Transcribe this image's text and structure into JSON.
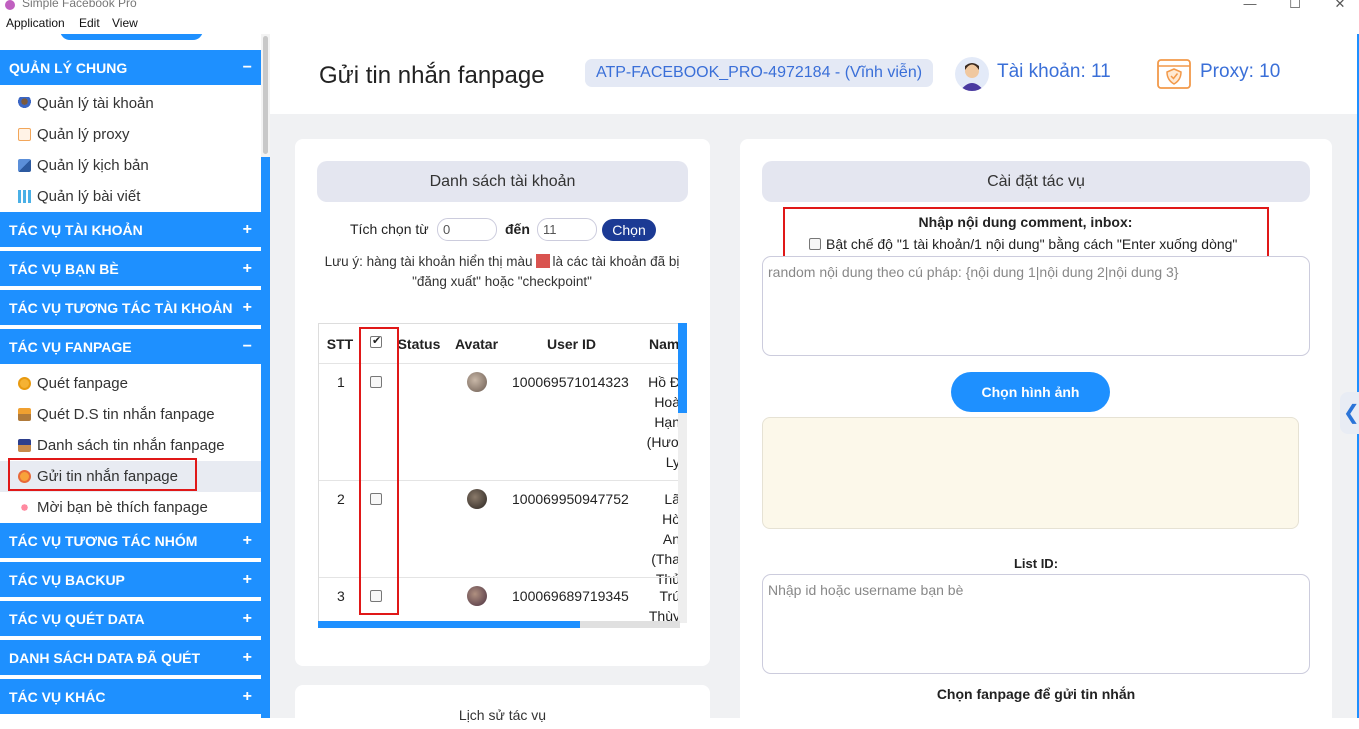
{
  "window": {
    "title": "Simple Facebook Pro",
    "buttons": [
      "—",
      "☐",
      "✕"
    ]
  },
  "menu": [
    "Application",
    "Edit",
    "View"
  ],
  "sidebar": {
    "sections": [
      {
        "label": "QUẢN LÝ CHUNG",
        "sign": "−",
        "items": [
          "Quản lý tài khoản",
          "Quản lý proxy",
          "Quản lý kịch bản",
          "Quản lý bài viết"
        ]
      },
      {
        "label": "TÁC VỤ TÀI KHOẢN",
        "sign": "+"
      },
      {
        "label": "TÁC VỤ BẠN BÈ",
        "sign": "+"
      },
      {
        "label": "TÁC VỤ TƯƠNG TÁC TÀI KHOẢN",
        "sign": "+"
      },
      {
        "label": "TÁC VỤ FANPAGE",
        "sign": "−",
        "items": [
          "Quét fanpage",
          "Quét D.S tin nhắn fanpage",
          "Danh sách tin nhắn fanpage",
          "Gửi tin nhắn fanpage",
          "Mời bạn bè thích fanpage"
        ]
      },
      {
        "label": "TÁC VỤ TƯƠNG TÁC NHÓM",
        "sign": "+"
      },
      {
        "label": "TÁC VỤ BACKUP",
        "sign": "+"
      },
      {
        "label": "TÁC VỤ QUÉT DATA",
        "sign": "+"
      },
      {
        "label": "DANH SÁCH DATA ĐÃ QUÉT",
        "sign": "+"
      },
      {
        "label": "TÁC VỤ KHÁC",
        "sign": "+"
      }
    ],
    "active_item": "Gửi tin nhắn fanpage"
  },
  "header": {
    "page_title": "Gửi tin nhắn fanpage",
    "license": "ATP-FACEBOOK_PRO-4972184 - (Vĩnh viễn)",
    "accounts": "Tài khoản: 11",
    "proxy": "Proxy: 10"
  },
  "account_list": {
    "title": "Danh sách tài khoản",
    "select_from_label": "Tích chọn từ",
    "from_value": "0",
    "to_label": "đến",
    "to_value": "11",
    "choose_button": "Chọn",
    "note_before": "Lưu ý: hàng tài khoản hiển thị màu",
    "note_after": "là các tài khoản đã bị \"đăng xuất\" hoặc \"checkpoint\"",
    "columns": [
      "STT",
      "",
      "Status",
      "Avatar",
      "User ID",
      "Nam"
    ],
    "rows": [
      {
        "stt": "1",
        "user_id": "100069571014323",
        "name_lines": [
          "Hồ Đ",
          "Hoà",
          "Hạn",
          "(Hươ",
          "Ly"
        ]
      },
      {
        "stt": "2",
        "user_id": "100069950947752",
        "name_lines": [
          "Lã Hò",
          "An",
          "(Tha",
          "Thủ"
        ]
      },
      {
        "stt": "3",
        "user_id": "100069689719345",
        "name_lines": [
          "Trú",
          "Thùy"
        ]
      }
    ]
  },
  "history": {
    "title": "Lịch sử tác vụ"
  },
  "settings": {
    "title": "Cài đặt tác vụ",
    "comment_label": "Nhập nội dung comment, inbox:",
    "mode_checkbox": "Bật chế độ \"1 tài khoản/1 nội dung\" bằng cách \"Enter xuống dòng\"",
    "content_placeholder": "random nội dung theo cú pháp: {nội dung 1|nội dung 2|nội dung 3}",
    "image_button": "Chọn hình ảnh",
    "list_id_label": "List ID:",
    "list_id_placeholder": "Nhập id hoặc username bạn bè",
    "fanpage_label": "Chọn fanpage để gửi tin nhắn"
  },
  "colors": {
    "primary": "#1e90ff",
    "navy": "#1c3a94",
    "highlight_red": "#e01818",
    "checkpoint_red": "#d9534f"
  }
}
